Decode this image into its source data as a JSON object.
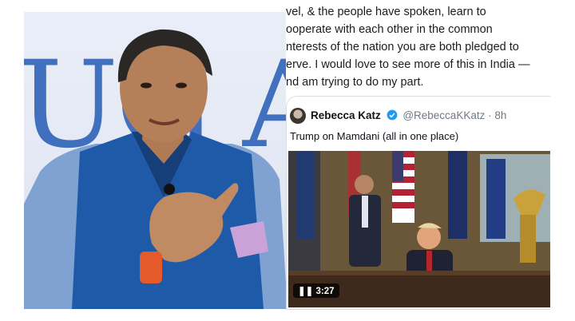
{
  "tweet": {
    "lines": [
      "vel, & the people have spoken, learn to",
      "ooperate with each other in the common",
      "nterests of the nation you are both pledged to",
      "erve. I would love to see more of this in India —",
      "nd am trying to do my part."
    ]
  },
  "quoted_tweet": {
    "author_name": "Rebecca Katz",
    "handle": "@RebeccaKKatz",
    "time": "· 8h",
    "text": "Trump on Mamdani (all in one place)",
    "video_duration": "3:27"
  },
  "photo": {
    "backdrop_text": "UG A"
  },
  "colors": {
    "verified_badge": "#1d9bf0",
    "backdrop_blue": "#2f63b8",
    "vest_blue": "#1f5aa8"
  }
}
